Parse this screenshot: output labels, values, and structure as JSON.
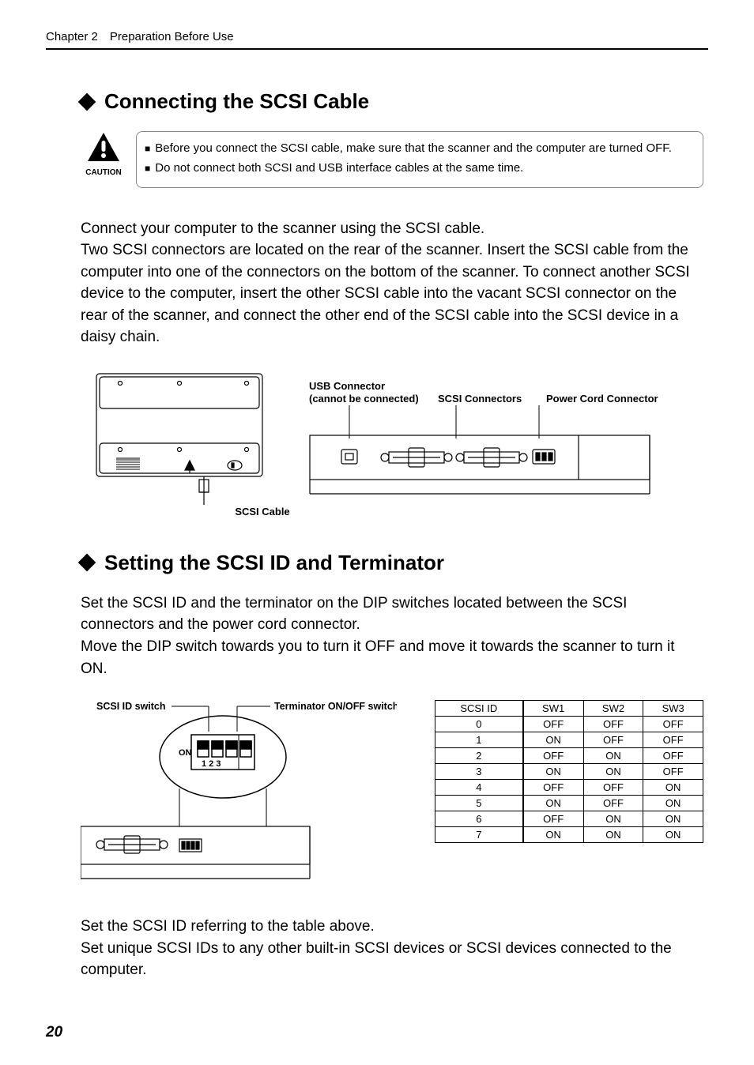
{
  "header": "Chapter 2 Preparation Before Use",
  "sec1": {
    "title": "Connecting the SCSI Cable",
    "cautionLabel": "CAUTION",
    "caution1": "Before you connect the SCSI cable, make sure that the scanner and the computer are turned OFF.",
    "caution2": "Do not connect both SCSI and USB interface cables at the same time.",
    "body": "Connect your computer to the scanner using the SCSI cable.\nTwo SCSI connectors are located on the rear of the scanner. Insert the SCSI cable from the computer into one of the connectors on the bottom of the scanner. To connect another SCSI device to the computer, insert the other SCSI cable into the vacant SCSI connector on the rear of the scanner, and connect the other end of the SCSI cable into the SCSI device in a daisy chain.",
    "fig": {
      "usb": "USB Connector",
      "usbNote": "(cannot be connected)",
      "scsiConn": "SCSI Connectors",
      "powerConn": "Power Cord Connector",
      "scsiCable": "SCSI Cable"
    }
  },
  "sec2": {
    "title": "Setting the SCSI ID and Terminator",
    "body": "Set the SCSI ID and the terminator on the DIP switches located between the SCSI connectors and the power cord connector.\nMove the DIP switch towards you to turn it OFF and move it towards the scanner to turn it ON.",
    "dip": {
      "leftLabel": "SCSI ID switch",
      "rightLabel": "Terminator ON/OFF switch",
      "on": "ON",
      "nums": "1 2 3"
    },
    "table": {
      "h": [
        "SCSI ID",
        "SW1",
        "SW2",
        "SW3"
      ],
      "rows": [
        [
          "0",
          "OFF",
          "OFF",
          "OFF"
        ],
        [
          "1",
          "ON",
          "OFF",
          "OFF"
        ],
        [
          "2",
          "OFF",
          "ON",
          "OFF"
        ],
        [
          "3",
          "ON",
          "ON",
          "OFF"
        ],
        [
          "4",
          "OFF",
          "OFF",
          "ON"
        ],
        [
          "5",
          "ON",
          "OFF",
          "ON"
        ],
        [
          "6",
          "OFF",
          "ON",
          "ON"
        ],
        [
          "7",
          "ON",
          "ON",
          "ON"
        ]
      ]
    },
    "footer": "Set the SCSI ID referring to the table above.\nSet unique SCSI IDs to any other built-in SCSI devices or SCSI devices connected to the computer."
  },
  "pageNumber": "20"
}
